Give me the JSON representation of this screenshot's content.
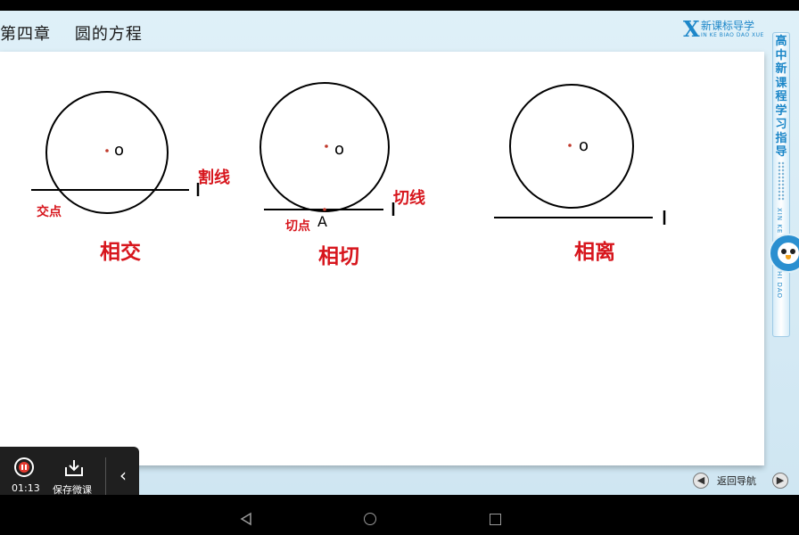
{
  "header": {
    "chapter_title": "第四章    圆的方程",
    "brand_letter": "X",
    "brand_name": "新课标导学",
    "brand_pinyin": "IN KE BIAO DAO XUE"
  },
  "slide": {
    "figures": [
      {
        "title": "相交",
        "center_label": "o",
        "line_label": "割线",
        "point_label": "交点"
      },
      {
        "title": "相切",
        "center_label": "o",
        "line_label": "切线",
        "point_label": "切点",
        "tangent_point": "A"
      },
      {
        "title": "相离",
        "center_label": "o"
      }
    ]
  },
  "sidebar": {
    "title": "高中新课程学习指导",
    "pinyin": "XIN KE XUE XI ZHI DAO"
  },
  "footer_nav": {
    "label": "返回导航"
  },
  "player": {
    "time": "01:13",
    "save_label": "保存微课"
  },
  "colors": {
    "accent_red": "#d7161d",
    "brand_blue": "#1d87c9",
    "center_dot": "#c0392b"
  }
}
